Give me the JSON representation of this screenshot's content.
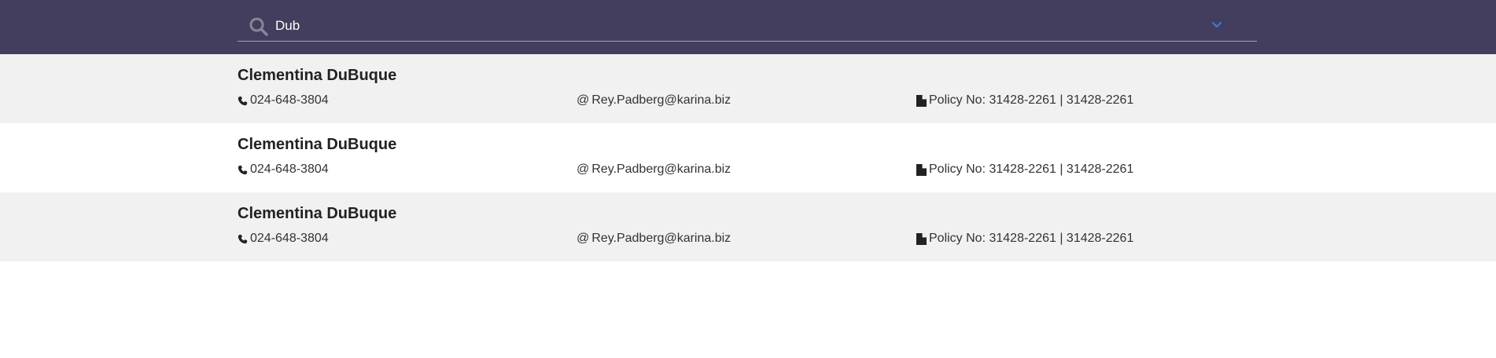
{
  "search": {
    "value": "Dub",
    "colors": {
      "bar_background": "#433d5e",
      "icon": "#8a8699",
      "chevron": "#3a7bd5"
    }
  },
  "results": [
    {
      "name": "Clementina DuBuque",
      "phone": "024-648-3804",
      "email_symbol": "@",
      "email": "Rey.Padberg@karina.biz",
      "policy": "Policy No: 31428-2261 | 31428-2261"
    },
    {
      "name": "Clementina DuBuque",
      "phone": "024-648-3804",
      "email_symbol": "@",
      "email": "Rey.Padberg@karina.biz",
      "policy": "Policy No: 31428-2261 | 31428-2261"
    },
    {
      "name": "Clementina DuBuque",
      "phone": "024-648-3804",
      "email_symbol": "@",
      "email": "Rey.Padberg@karina.biz",
      "policy": "Policy No: 31428-2261 | 31428-2261"
    }
  ],
  "icons": {
    "search": "search-icon",
    "dropdown": "chevron-down-icon",
    "phone": "phone-icon",
    "policy": "document-icon"
  }
}
